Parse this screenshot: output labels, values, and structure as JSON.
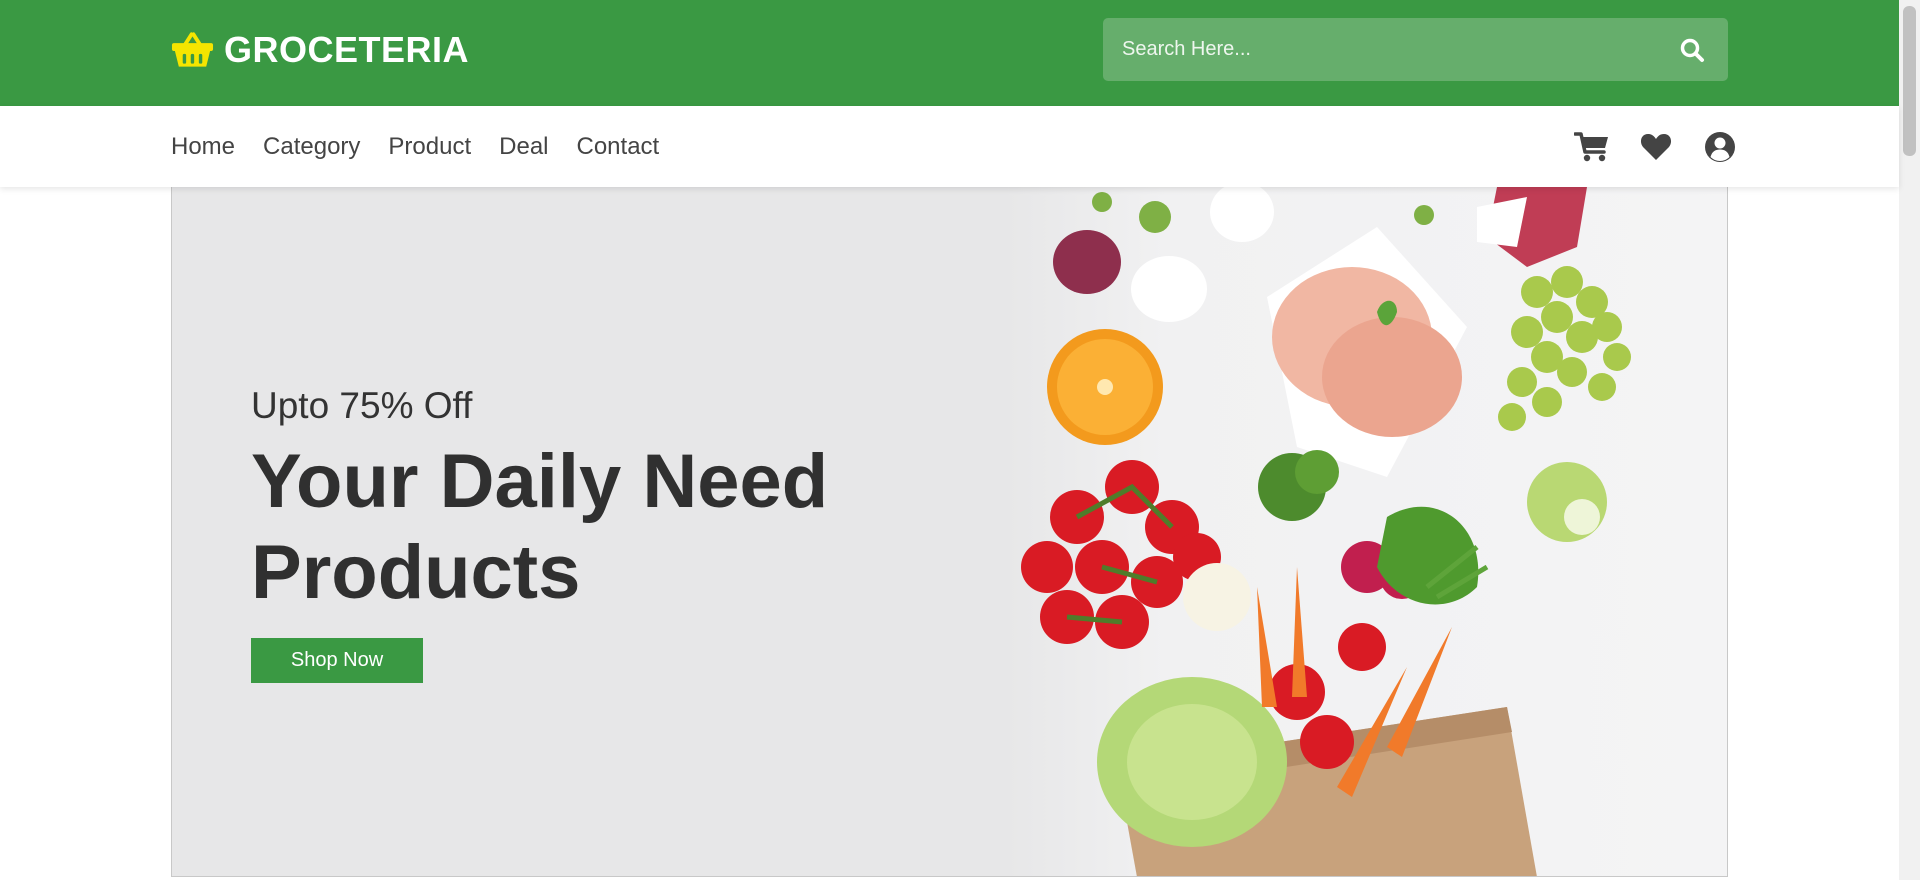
{
  "header": {
    "brand": "GROCETERIA",
    "search_placeholder": "Search Here...",
    "colors": {
      "primary": "#3a9943",
      "logo_icon": "#f5e500"
    }
  },
  "nav": {
    "links": [
      "Home",
      "Category",
      "Product",
      "Deal",
      "Contact"
    ],
    "icons": [
      "cart-icon",
      "heart-icon",
      "user-circle-icon"
    ]
  },
  "hero": {
    "subtitle": "Upto 75% Off",
    "title": "Your Daily Need Products",
    "button_label": "Shop Now"
  }
}
